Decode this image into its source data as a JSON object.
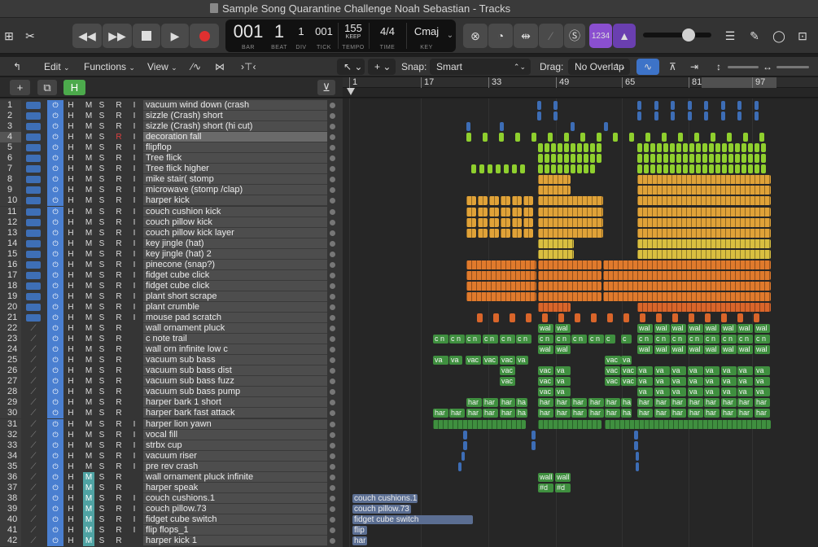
{
  "window": {
    "title": "Sample Song Quarantine Challenge Noah Sebastian  - Tracks"
  },
  "lcd": {
    "bar": "001",
    "beat": "1",
    "div": "1",
    "tick": "001",
    "tempo": "155",
    "tempo_mode": "KEEP",
    "time_sig": "4/4",
    "key": "Cmaj",
    "labels": {
      "bar": "BAR",
      "beat": "BEAT",
      "div": "DIV",
      "tick": "TICK",
      "tempo": "TEMPO",
      "time": "TIME",
      "key": "KEY"
    }
  },
  "count_in": "1234",
  "menus": {
    "edit": "Edit",
    "functions": "Functions",
    "view": "View"
  },
  "snap": {
    "label": "Snap:",
    "value": "Smart"
  },
  "drag": {
    "label": "Drag:",
    "value": "No Overlap"
  },
  "ruler": {
    "bars": [
      "1",
      "17",
      "33",
      "49",
      "65",
      "81",
      "97"
    ]
  },
  "track_buttons": {
    "h": "H",
    "m": "M",
    "s": "S",
    "r": "R",
    "i": "I"
  },
  "tracks": [
    {
      "num": "1",
      "name": "vacuum wind down (crash"
    },
    {
      "num": "2",
      "name": "sizzle (Crash) short"
    },
    {
      "num": "3",
      "name": "sizzle (Crash) short (hi cut)"
    },
    {
      "num": "4",
      "name": "decoration fall"
    },
    {
      "num": "5",
      "name": "flipflop"
    },
    {
      "num": "6",
      "name": "Tree flick"
    },
    {
      "num": "7",
      "name": "Tree flick higher"
    },
    {
      "num": "8",
      "name": "mike stair( stomp"
    },
    {
      "num": "9",
      "name": "microwave (stomp /clap)"
    },
    {
      "num": "10",
      "name": "harper kick"
    },
    {
      "num": "11",
      "name": "couch cushion kick"
    },
    {
      "num": "12",
      "name": "couch pillow kick"
    },
    {
      "num": "13",
      "name": "couch pillow kick layer"
    },
    {
      "num": "14",
      "name": "key jingle (hat)"
    },
    {
      "num": "15",
      "name": "key jingle (hat) 2"
    },
    {
      "num": "16",
      "name": "pinecone (snap?)"
    },
    {
      "num": "17",
      "name": "fidget cube click"
    },
    {
      "num": "18",
      "name": "fidget cube click"
    },
    {
      "num": "19",
      "name": "plant short scrape"
    },
    {
      "num": "20",
      "name": "plant crumble"
    },
    {
      "num": "21",
      "name": "mouse pad scratch"
    },
    {
      "num": "22",
      "name": "wall ornament pluck"
    },
    {
      "num": "23",
      "name": "c note trail"
    },
    {
      "num": "24",
      "name": "wall orn infinite low c"
    },
    {
      "num": "25",
      "name": "vacuum sub bass"
    },
    {
      "num": "26",
      "name": "vacuum sub bass dist"
    },
    {
      "num": "27",
      "name": "vacuum sub bass fuzz"
    },
    {
      "num": "28",
      "name": "vacuum sub bass pump"
    },
    {
      "num": "29",
      "name": "harper bark 1 short"
    },
    {
      "num": "30",
      "name": "harper bark fast attack"
    },
    {
      "num": "31",
      "name": "harper lion yawn"
    },
    {
      "num": "32",
      "name": "vocal fill"
    },
    {
      "num": "33",
      "name": "strbx cup"
    },
    {
      "num": "34",
      "name": "vacuum riser"
    },
    {
      "num": "35",
      "name": "pre rev crash"
    },
    {
      "num": "36",
      "name": "wall ornament pluck infinite"
    },
    {
      "num": "37",
      "name": "harper speak"
    },
    {
      "num": "38",
      "name": "couch cushions.1"
    },
    {
      "num": "39",
      "name": "couch pillow.73"
    },
    {
      "num": "40",
      "name": "fidget cube switch"
    },
    {
      "num": "41",
      "name": "flip flops_1"
    },
    {
      "num": "42",
      "name": "harper kick 1"
    }
  ],
  "region_labels": {
    "wall": "wal",
    "cn": "c n",
    "vac": "vac",
    "va": "va",
    "har": "har",
    "ha": "ha",
    "h": "h",
    "c": "c",
    "wall_full": "wall",
    "hd": "#d",
    "couch_cushions": "couch cushions.1",
    "couch_pillow": "couch pillow.73",
    "fidget_switch": "fidget cube switch",
    "flip": "flip",
    "harper": "har"
  },
  "colors": {
    "blue": "#3d6db5",
    "lime": "#8fcf2e",
    "amber": "#e0a238",
    "orange": "#e07a2c",
    "yellow": "#d9bf40",
    "green": "#3f8f3f",
    "record": "#e03030",
    "accent_purple": "#8a4fcf"
  }
}
